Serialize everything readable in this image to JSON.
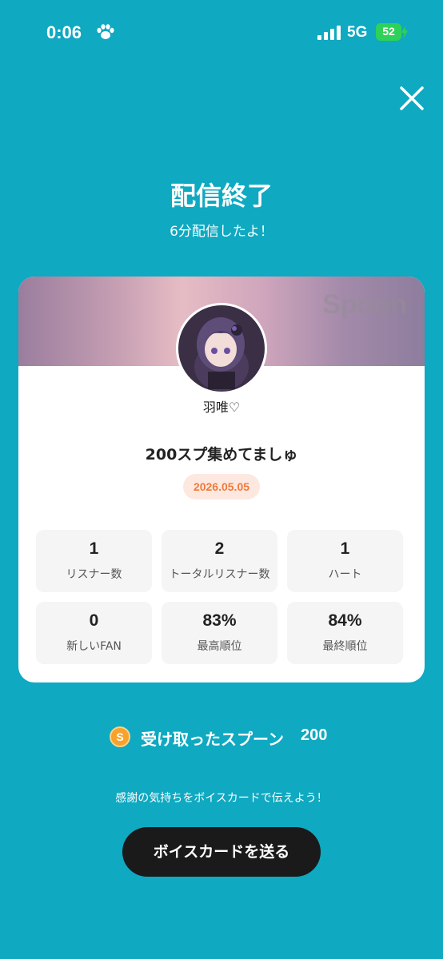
{
  "status_bar": {
    "time": "0:06",
    "network": "5G",
    "battery": "52",
    "paw_icon": "paw-icon",
    "signal_icon": "signal-icon"
  },
  "header": {
    "title": "配信終了",
    "subtitle": "6分配信したよ！",
    "close_icon": "close-icon"
  },
  "card": {
    "brand": "Spoon",
    "username": "羽唯♡",
    "stream_title": "200スプ集めてましゅ",
    "date": "2026.05.05",
    "stats": [
      {
        "value": "1",
        "label": "リスナー数"
      },
      {
        "value": "2",
        "label": "トータルリスナー数"
      },
      {
        "value": "1",
        "label": "ハート"
      },
      {
        "value": "0",
        "label": "新しいFAN"
      },
      {
        "value": "83%",
        "label": "最高順位"
      },
      {
        "value": "84%",
        "label": "最終順位"
      }
    ]
  },
  "spoons": {
    "coin_letter": "S",
    "label": "受け取ったスプーン",
    "count": "200"
  },
  "footer": {
    "message": "感謝の気持ちをボイスカードで伝えよう！",
    "button_label": "ボイスカードを送る"
  },
  "colors": {
    "background": "#0fa9c1",
    "date_text": "#f07a3b",
    "date_bg": "#fde8e0",
    "button_bg": "#1a1a1a",
    "coin": "#f7a22a"
  }
}
